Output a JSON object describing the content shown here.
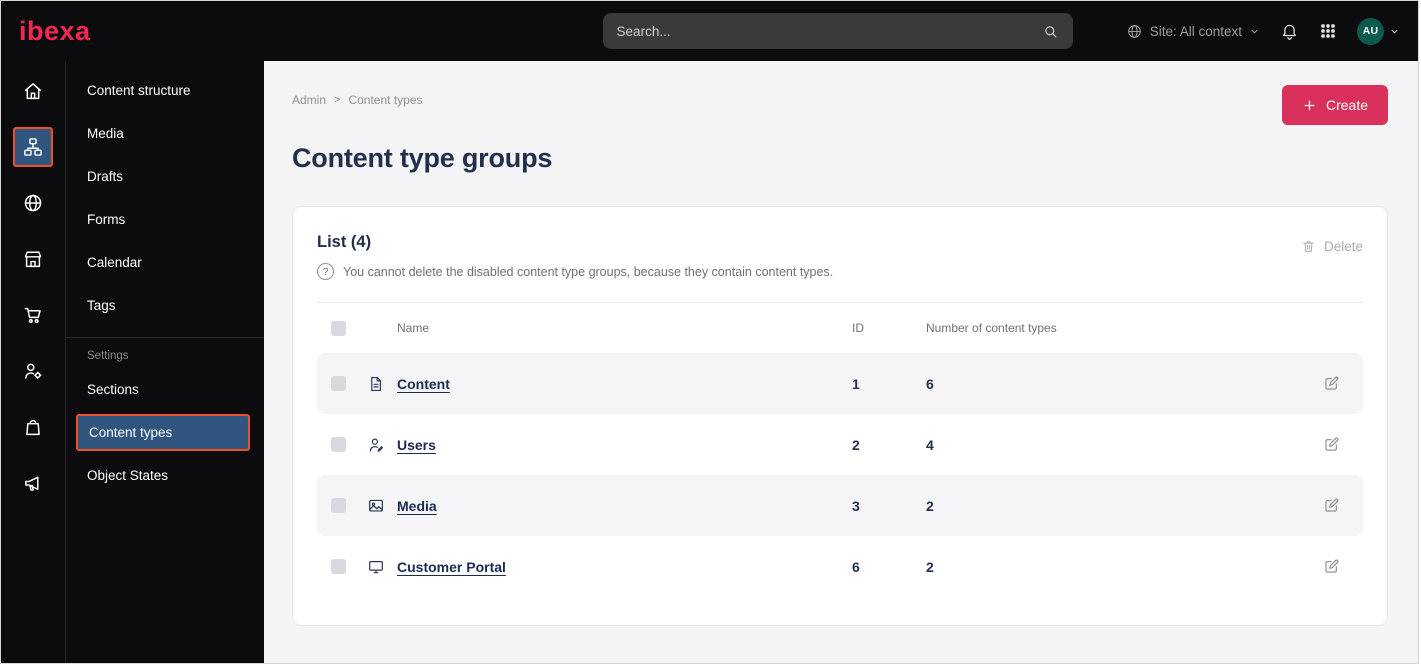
{
  "topbar": {
    "logo_text": "ibexa",
    "search": {
      "placeholder": "Search..."
    },
    "site_context_label": "Site: All context",
    "avatar_initials": "AU"
  },
  "icon_rail": {
    "items": [
      {
        "icon": "home-icon",
        "active": false
      },
      {
        "icon": "content-structure-icon",
        "active": true
      },
      {
        "icon": "site-icon",
        "active": false
      },
      {
        "icon": "commerce-store-icon",
        "active": false
      },
      {
        "icon": "cart-icon",
        "active": false
      },
      {
        "icon": "user-admin-icon",
        "active": false
      },
      {
        "icon": "product-catalog-icon",
        "active": false
      },
      {
        "icon": "marketing-icon",
        "active": false
      }
    ]
  },
  "sidebar": {
    "items": [
      "Content structure",
      "Media",
      "Drafts",
      "Forms",
      "Calendar",
      "Tags"
    ],
    "settings_label": "Settings",
    "settings_items": [
      "Sections",
      "Content types",
      "Object States"
    ],
    "active_item": "Content types"
  },
  "main": {
    "breadcrumb": {
      "items": [
        "Admin",
        "Content types"
      ],
      "separator": ">"
    },
    "create_button_label": "Create",
    "page_title": "Content type groups",
    "card": {
      "list_title": "List (4)",
      "help_icon_glyph": "?",
      "info_text": "You cannot delete the disabled content type groups, because they contain content types.",
      "delete_button_label": "Delete",
      "table": {
        "columns": [
          "Name",
          "ID",
          "Number of content types"
        ],
        "rows": [
          {
            "name": "Content",
            "icon": "file-icon",
            "id": "1",
            "count": "6"
          },
          {
            "name": "Users",
            "icon": "user-icon",
            "id": "2",
            "count": "4"
          },
          {
            "name": "Media",
            "icon": "image-icon",
            "id": "3",
            "count": "2"
          },
          {
            "name": "Customer Portal",
            "icon": "monitor-icon",
            "id": "6",
            "count": "2"
          }
        ]
      }
    }
  },
  "colors": {
    "topbar_bg": "#0c0c0e",
    "logo_red": "#f22853",
    "accent_red": "#d9305c",
    "highlight_orange": "#f04e23",
    "selected_blue": "#30567f",
    "navy_text": "#22304e",
    "main_bg": "#f4f4f7",
    "row_shade": "#f5f5f8",
    "avatar_teal": "#0f5a50"
  }
}
